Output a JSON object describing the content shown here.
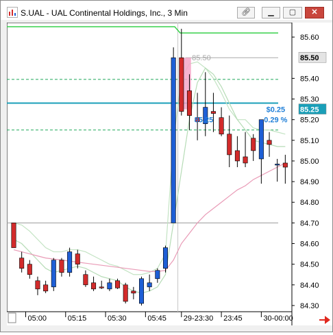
{
  "window": {
    "title": "S.UAL - UAL Continental Holdings, Inc., 3 Min",
    "buttons": [
      "link-icon",
      "minimize-icon",
      "maximize-icon",
      "close-icon"
    ]
  },
  "chart_data": {
    "type": "candlestick",
    "symbol": "S.UAL",
    "interval": "3 Min",
    "y_ticks": [
      "85.60",
      "85.40",
      "85.30",
      "85.20",
      "85.10",
      "85.00",
      "84.90",
      "84.80",
      "84.70",
      "84.60",
      "84.50",
      "84.40",
      "84.30"
    ],
    "y_tick_values": [
      85.6,
      85.4,
      85.3,
      85.2,
      85.1,
      85.0,
      84.9,
      84.8,
      84.7,
      84.6,
      84.5,
      84.4,
      84.3
    ],
    "x_ticks": [
      {
        "label": "05:00",
        "index": 1.5
      },
      {
        "label": "05:15",
        "index": 6.5
      },
      {
        "label": "05:30",
        "index": 11.5
      },
      {
        "label": "05:45",
        "index": 16.5
      },
      {
        "label": "29-23:30",
        "index": 21.0
      },
      {
        "label": "23:45",
        "index": 26.0
      },
      {
        "label": "30-00:00",
        "index": 31.0
      }
    ],
    "ylim": [
      84.27,
      85.67
    ],
    "x_count": 35,
    "price_labels": [
      {
        "text": "85.50",
        "value": 85.5,
        "bg": "#e4e4e4",
        "fg": "#000000"
      },
      {
        "text": "85.25",
        "value": 85.25,
        "bg": "#1a9fb8",
        "fg": "#ffffff"
      }
    ],
    "annotations": [
      {
        "text": "85.50",
        "value": 85.5,
        "index": 23.5,
        "color": "#a8a8a8"
      },
      {
        "text": "$0.25",
        "value": 85.25,
        "index": 32.8,
        "color": "#1f7fd8"
      },
      {
        "text": "0.29 %",
        "value": 85.2,
        "index": 32.8,
        "color": "#1f7fd8"
      },
      {
        "text": "85.25",
        "value": 85.2,
        "index": 23.8,
        "color": "#1f7fd8"
      }
    ],
    "hlines": [
      {
        "value": 85.395,
        "color": "#1fa85a",
        "dash": "4,3",
        "width": 1
      },
      {
        "value": 85.28,
        "color": "#1a9fb8",
        "dash": "",
        "width": 2
      },
      {
        "value": 85.15,
        "color": "#1fa85a",
        "dash": "4,3",
        "width": 1
      },
      {
        "value": 85.5,
        "color": "#a8a8a8",
        "dash": "",
        "width": 1,
        "from": 21.5
      },
      {
        "value": 84.7,
        "color": "#9a9a9a",
        "dash": "",
        "width": 1
      }
    ],
    "session_line": {
      "before": 85.65,
      "after": 85.62,
      "break_index": 20.5,
      "color": "#37d04a"
    },
    "separator_index": 20.55,
    "candles": [
      {
        "o": 84.7,
        "h": 84.7,
        "l": 84.58,
        "c": 84.58
      },
      {
        "o": 84.53,
        "h": 84.56,
        "l": 84.46,
        "c": 84.48
      },
      {
        "o": 84.5,
        "h": 84.52,
        "l": 84.43,
        "c": 84.45
      },
      {
        "o": 84.42,
        "h": 84.44,
        "l": 84.35,
        "c": 84.38
      },
      {
        "o": 84.4,
        "h": 84.42,
        "l": 84.36,
        "c": 84.37
      },
      {
        "o": 84.39,
        "h": 84.53,
        "l": 84.37,
        "c": 84.52
      },
      {
        "o": 84.52,
        "h": 84.53,
        "l": 84.44,
        "c": 84.46
      },
      {
        "o": 84.46,
        "h": 84.58,
        "l": 84.44,
        "c": 84.56
      },
      {
        "o": 84.55,
        "h": 84.57,
        "l": 84.48,
        "c": 84.5
      },
      {
        "o": 84.45,
        "h": 84.47,
        "l": 84.39,
        "c": 84.4
      },
      {
        "o": 84.41,
        "h": 84.44,
        "l": 84.37,
        "c": 84.38
      },
      {
        "o": 84.39,
        "h": 84.42,
        "l": 84.38,
        "c": 84.385
      },
      {
        "o": 84.38,
        "h": 84.43,
        "l": 84.37,
        "c": 84.41
      },
      {
        "o": 84.42,
        "h": 84.43,
        "l": 84.38,
        "c": 84.385
      },
      {
        "o": 84.4,
        "h": 84.41,
        "l": 84.31,
        "c": 84.32
      },
      {
        "o": 84.37,
        "h": 84.39,
        "l": 84.33,
        "c": 84.36
      },
      {
        "o": 84.31,
        "h": 84.44,
        "l": 84.3,
        "c": 84.43
      },
      {
        "o": 84.39,
        "h": 84.45,
        "l": 84.37,
        "c": 84.41
      },
      {
        "o": 84.43,
        "h": 84.48,
        "l": 84.41,
        "c": 84.47
      },
      {
        "o": 84.48,
        "h": 84.59,
        "l": 84.46,
        "c": 84.58
      },
      {
        "o": 84.7,
        "h": 85.55,
        "l": 84.7,
        "c": 85.5
      },
      {
        "o": 85.5,
        "h": 85.64,
        "l": 85.22,
        "c": 85.24
      },
      {
        "o": 85.34,
        "h": 85.42,
        "l": 85.15,
        "c": 85.22
      },
      {
        "o": 85.21,
        "h": 85.33,
        "l": 85.1,
        "c": 85.19
      },
      {
        "o": 85.18,
        "h": 85.43,
        "l": 85.12,
        "c": 85.26
      },
      {
        "o": 85.24,
        "h": 85.33,
        "l": 85.14,
        "c": 85.23
      },
      {
        "o": 85.21,
        "h": 85.26,
        "l": 85.12,
        "c": 85.13
      },
      {
        "o": 85.13,
        "h": 85.22,
        "l": 84.97,
        "c": 85.03
      },
      {
        "o": 85.05,
        "h": 85.12,
        "l": 84.97,
        "c": 85.0
      },
      {
        "o": 85.02,
        "h": 85.14,
        "l": 84.97,
        "c": 84.99
      },
      {
        "o": 85.11,
        "h": 85.13,
        "l": 85.0,
        "c": 85.05
      },
      {
        "o": 85.01,
        "h": 85.2,
        "l": 84.89,
        "c": 85.2
      },
      {
        "o": 85.1,
        "h": 85.14,
        "l": 85.02,
        "c": 85.08
      },
      {
        "o": 84.98,
        "h": 85.01,
        "l": 84.9,
        "c": 84.985
      },
      {
        "o": 84.99,
        "h": 85.03,
        "l": 84.89,
        "c": 84.97
      }
    ],
    "up_color": "#1e5fd6",
    "down_color": "#d22b2b",
    "ma_fast": {
      "color": "#b6dcb6",
      "values": [
        84.62,
        84.6,
        84.56,
        84.52,
        84.48,
        84.46,
        84.47,
        84.48,
        84.49,
        84.48,
        84.46,
        84.44,
        84.43,
        84.42,
        84.39,
        84.37,
        84.36,
        84.37,
        84.39,
        84.45,
        84.7,
        84.95,
        85.2,
        85.38,
        85.45,
        85.42,
        85.36,
        85.28,
        85.2,
        85.15,
        85.1,
        85.09,
        85.08,
        85.07,
        85.07
      ]
    },
    "ma_slow": {
      "color": "#e99ab6",
      "values": [
        84.57,
        84.56,
        84.55,
        84.54,
        84.53,
        84.525,
        84.52,
        84.515,
        84.51,
        84.505,
        84.5,
        84.495,
        84.49,
        84.485,
        84.48,
        84.475,
        84.47,
        84.465,
        84.465,
        84.47,
        84.52,
        84.6,
        84.65,
        84.7,
        84.74,
        84.77,
        84.8,
        84.83,
        84.86,
        84.88,
        84.91,
        84.93,
        84.95,
        84.97,
        84.99
      ]
    },
    "band": {
      "color": "#c3e3c3",
      "values": [
        84.7,
        84.69,
        84.66,
        84.62,
        84.58,
        84.56,
        84.56,
        84.57,
        84.57,
        84.56,
        84.54,
        84.52,
        84.5,
        84.49,
        84.47,
        84.45,
        84.45,
        84.46,
        84.48,
        84.55,
        85.1,
        85.4,
        85.47,
        85.48,
        85.45,
        85.4,
        85.33,
        85.25,
        85.2,
        85.2,
        85.16,
        85.15,
        85.15,
        85.14,
        85.13
      ]
    },
    "highlight": {
      "index": 21.5,
      "from": 85.5,
      "to": 85.25,
      "color": "#f4a6c8"
    }
  }
}
